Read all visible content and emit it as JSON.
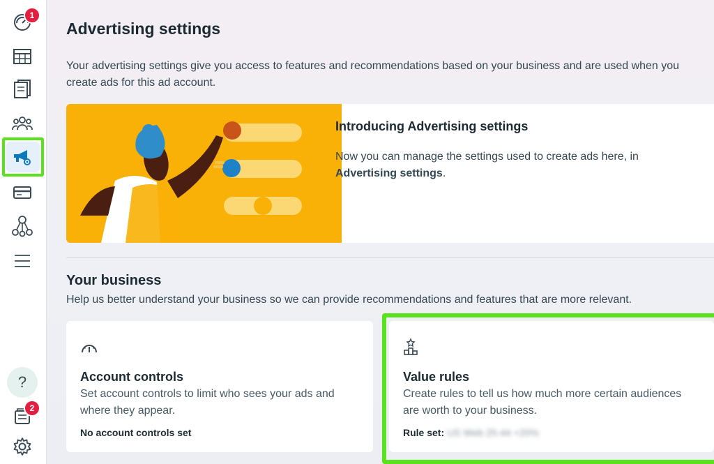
{
  "sidebar": {
    "items": [
      {
        "icon": "dashboard-icon",
        "badge": "1"
      },
      {
        "icon": "table-icon"
      },
      {
        "icon": "pages-icon"
      },
      {
        "icon": "audience-icon"
      },
      {
        "icon": "megaphone-settings-icon",
        "active": true
      },
      {
        "icon": "billing-card-icon"
      },
      {
        "icon": "network-icon"
      },
      {
        "icon": "menu-icon"
      }
    ],
    "help_label": "?",
    "notifications_badge": "2",
    "settings_icon": "gear-icon"
  },
  "page": {
    "title": "Advertising settings",
    "intro": "Your advertising settings give you access to features and recommendations based on your business and are used when you create ads for this ad account."
  },
  "banner": {
    "title": "Introducing Advertising settings",
    "text_before": "Now you can manage the settings used to create ads here, in ",
    "text_bold": "Advertising settings",
    "text_after": "."
  },
  "business": {
    "title": "Your business",
    "subtitle": "Help us better understand your business so we can provide recommendations and features that are more relevant."
  },
  "cards": {
    "account_controls": {
      "icon": "gauge-icon",
      "title": "Account controls",
      "text": "Set account controls to limit who sees your ads and where they appear.",
      "meta": "No account controls set"
    },
    "value_rules": {
      "icon": "podium-icon",
      "title": "Value rules",
      "text": "Create rules to tell us how much more certain audiences are worth to your business.",
      "meta_label": "Rule set:",
      "meta_value": "US Web 25-44 +20%"
    }
  },
  "colors": {
    "accent_highlight": "#5ae21f",
    "banner_bg": "#f9b007",
    "badge": "#e41e3f",
    "active_icon": "#0a78be"
  }
}
